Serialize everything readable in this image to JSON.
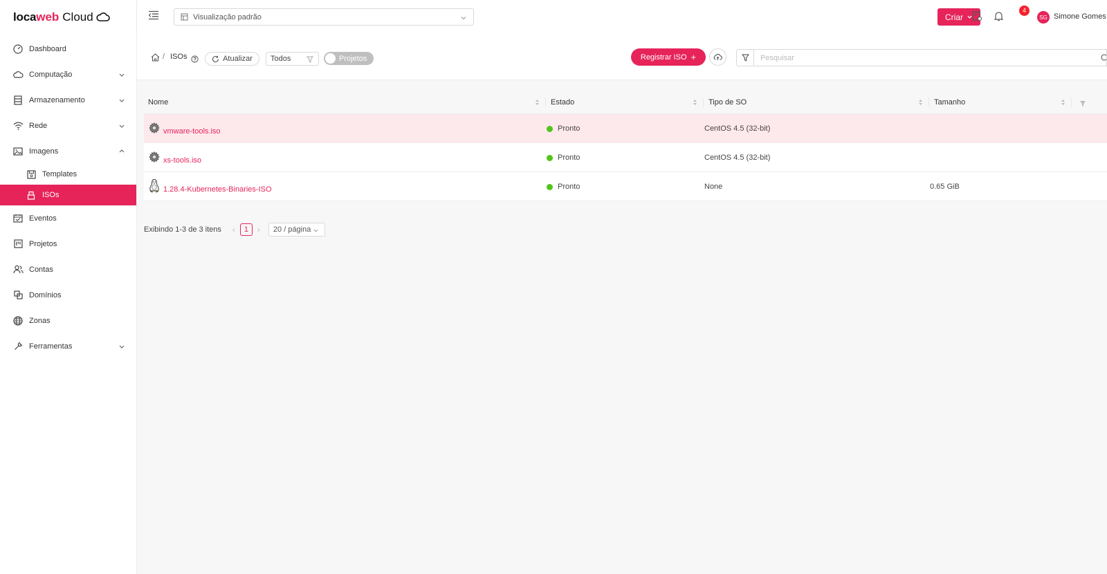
{
  "app": {
    "logo_part1": "loca",
    "logo_part2": "web",
    "logo_part3": "Cloud",
    "brand_color": "#e6245a"
  },
  "sidebar": {
    "items": [
      {
        "label": "Dashboard",
        "icon": "dashboard-icon"
      },
      {
        "label": "Computação",
        "icon": "cloud-icon",
        "expandable": true
      },
      {
        "label": "Armazenamento",
        "icon": "storage-icon",
        "expandable": true
      },
      {
        "label": "Rede",
        "icon": "wifi-icon",
        "expandable": true
      },
      {
        "label": "Imagens",
        "icon": "image-icon",
        "expandable": true,
        "expanded": true
      },
      {
        "label": "Templates",
        "icon": "save-icon",
        "sub": true
      },
      {
        "label": "ISOs",
        "icon": "usb-icon",
        "sub": true,
        "active": true
      },
      {
        "label": "Eventos",
        "icon": "schedule-icon"
      },
      {
        "label": "Projetos",
        "icon": "project-icon"
      },
      {
        "label": "Contas",
        "icon": "team-icon"
      },
      {
        "label": "Domínios",
        "icon": "block-icon"
      },
      {
        "label": "Zonas",
        "icon": "global-icon"
      },
      {
        "label": "Ferramentas",
        "icon": "tool-icon",
        "expandable": true
      }
    ]
  },
  "header": {
    "view_select": "Visualização padrão",
    "create_label": "Criar",
    "notification_count": "4",
    "avatar_initials": "SG",
    "user_name": "Simone Gomes"
  },
  "toolbar": {
    "breadcrumb_current": "ISOs",
    "breadcrumb_sep": "/",
    "refresh_label": "Atualizar",
    "filter_value": "Todos",
    "projects_toggle_label": "Projetos",
    "register_label": "Registrar ISO",
    "search_placeholder": "Pesquisar"
  },
  "table": {
    "columns": [
      "Nome",
      "Estado",
      "Tipo de SO",
      "Tamanho"
    ],
    "rows": [
      {
        "name": "vmware-tools.iso",
        "icon": "gear-icon",
        "state": "Pronto",
        "os": "CentOS 4.5 (32-bit)",
        "size": "",
        "highlighted": true
      },
      {
        "name": "xs-tools.iso",
        "icon": "gear-icon",
        "state": "Pronto",
        "os": "CentOS 4.5 (32-bit)",
        "size": ""
      },
      {
        "name": "1.28.4-Kubernetes-Binaries-ISO",
        "icon": "linux-icon",
        "state": "Pronto",
        "os": "None",
        "size": "0.65 GiB"
      }
    ],
    "status_color": "#52c41a"
  },
  "pagination": {
    "total_text": "Exibindo 1-3 de 3 itens",
    "current_page": "1",
    "page_size": "20 / página"
  }
}
